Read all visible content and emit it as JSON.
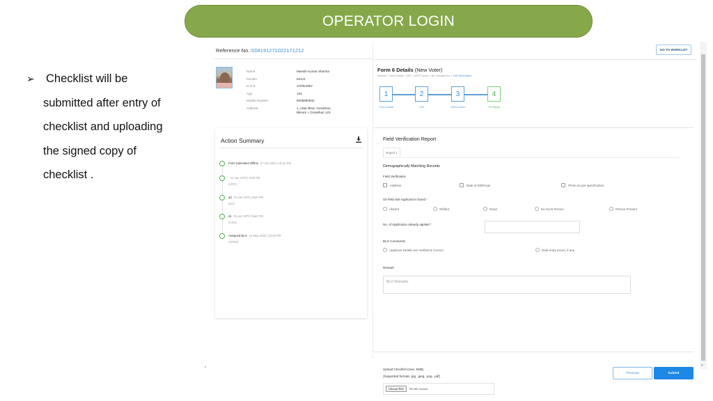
{
  "slide": {
    "banner_title": "OPERATOR LOGIN",
    "bullet_lines": [
      "Checklist will be",
      "submitted after entry of",
      "checklist and uploading",
      "the signed copy of",
      "checklist ."
    ],
    "bullet_icon": "arrow-bullet-icon"
  },
  "app": {
    "reference": {
      "label": "Reference No.:",
      "value": "S04191271022171212"
    },
    "person": {
      "fields": [
        {
          "key": "Name",
          "value": "Manish Kumar Sharma"
        },
        {
          "key": "Gender",
          "value": "MALE"
        },
        {
          "key": "D.O.B",
          "value": "27/05/1897"
        },
        {
          "key": "Age",
          "value": "126"
        },
        {
          "key": "Mobile Number",
          "value": "9008890932"
        },
        {
          "key": "Address",
          "value": "1, Uttar Bhar, Gorakhari, Bikram I, Gorakhari 123"
        }
      ]
    },
    "action_summary": {
      "title": "Action Summary",
      "download_icon": "download-icon",
      "items": [
        {
          "main": "Form Submitted Offline",
          "timestamp": "27 Oct 2022 | 05:21 PM",
          "sub": ""
        },
        {
          "main": "",
          "timestamp": "01 Jan 1970 | NaN PM",
          "sub": "(ARO)"
        },
        {
          "main": "ad",
          "timestamp": "01 Jan 1970 | NaN PM",
          "sub": "(SO)"
        },
        {
          "main": "ok",
          "timestamp": "01 Jan 1970 | NaN PM",
          "sub": "(CSO)"
        },
        {
          "main": "Assigned BLO",
          "timestamp": "14 May 2022 | 10:48 PM",
          "sub": "(AERO)"
        }
      ]
    },
    "header": {
      "worklist_button": "GO TO WORKLIST",
      "form_title_bold": "Form 6 Details",
      "form_title_rest": " (New Voter)",
      "breadcrumb": [
        "Worklist",
        "Form Details",
        "DSE",
        "AERO Action",
        "BLO Assignment",
        "FVR Submission"
      ],
      "breadcrumb_sep": " > "
    },
    "stepper": {
      "steps": [
        {
          "num": "1",
          "label": "Form Details",
          "done": false
        },
        {
          "num": "2",
          "label": "DSE",
          "done": false
        },
        {
          "num": "3",
          "label": "AERO Action",
          "done": false
        },
        {
          "num": "4",
          "label": "FV Report",
          "done": true
        }
      ]
    },
    "fvr": {
      "title": "Field Verification Report",
      "tab": "Report 1",
      "dmr_heading": "Demographically Matching Records",
      "field_verification_label": "Field Verification",
      "checkboxes": [
        "Address",
        "Date of Birth/Age",
        "Photo as per specification"
      ],
      "found_label": "On field visit Applicant is found",
      "required_mark": "*",
      "found_options": [
        "Absent",
        "Shifted",
        "Dead",
        "No Such Person",
        "Person Present"
      ],
      "applications_label": "No. of Application already applied",
      "applications_value": "",
      "blo_comments_label": "BLO Comments",
      "blo_options": [
        "Applicant Details are Verified & Correct",
        "Data entry errors, if any"
      ],
      "remark_label": "Remark",
      "remark_placeholder": "BLO Remarks"
    },
    "upload": {
      "label_line1": "Upload Checklist (max. 5MB)",
      "label_line2": "(Supported formats .jpg, .jpeg, .png, .pdf)",
      "choose_button": "Choose File",
      "file_status": "No file chosen"
    },
    "actions": {
      "previous": "Previous",
      "submit": "Submit"
    },
    "colors": {
      "accent": "#1e88e5",
      "banner": "#86a84a",
      "step_done": "#4caf50",
      "link": "#3a8fd6"
    }
  }
}
